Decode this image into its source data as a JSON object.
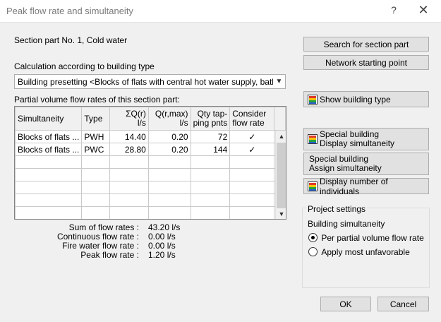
{
  "window": {
    "title": "Peak flow rate and simultaneity",
    "help_glyph": "?",
    "close_glyph": "✕"
  },
  "section_part": "Section part No. 1, Cold water",
  "calc_label": "Calculation according to building type",
  "calc_select": {
    "value": "Building presetting <Blocks of flats with central hot water supply, bath tub or"
  },
  "partial_label": "Partial volume flow rates of this section part:",
  "table": {
    "headers": {
      "simultaneity": "Simultaneity",
      "type": "Type",
      "sum_q_1": "ΣQ(r)",
      "sum_q_2": "l/s",
      "q_max_1": "Q(r,max)",
      "q_max_2": "l/s",
      "qty_1": "Qty tap-",
      "qty_2": "ping pnts",
      "consider_1": "Consider",
      "consider_2": "flow rate"
    },
    "rows": [
      {
        "simultaneity": "Blocks of flats ...",
        "type": "PWH",
        "sum_q": "14.40",
        "q_max": "0.20",
        "qty": "72",
        "consider": "✓"
      },
      {
        "simultaneity": "Blocks of flats ...",
        "type": "PWC",
        "sum_q": "28.80",
        "q_max": "0.20",
        "qty": "144",
        "consider": "✓"
      }
    ]
  },
  "summary": {
    "sum_label": "Sum of flow rates :",
    "sum_value": "43.20 l/s",
    "cont_label": "Continuous flow rate :",
    "cont_value": "0.00 l/s",
    "fire_label": "Fire water flow rate :",
    "fire_value": "0.00 l/s",
    "peak_label": "Peak flow rate :",
    "peak_value": "1.20 l/s"
  },
  "buttons": {
    "search": "Search for section part",
    "network": "Network starting point",
    "show_building": "Show building type",
    "special_display_1": "Special building",
    "special_display_2": "Display simultaneity",
    "special_assign_1": "Special building",
    "special_assign_2": "Assign simultaneity",
    "display_individuals": "Display number of individuals",
    "ok": "OK",
    "cancel": "Cancel"
  },
  "project_settings": {
    "legend": "Project settings",
    "building_simultaneity": "Building simultaneity",
    "option_1": "Per partial volume flow rate",
    "option_2": "Apply most unfavorable",
    "selected": "Per partial volume flow rate"
  },
  "icons": {
    "building": "building-type-icon",
    "scroll_up": "▲",
    "scroll_down": "▼",
    "combo_arrow": "▼"
  }
}
